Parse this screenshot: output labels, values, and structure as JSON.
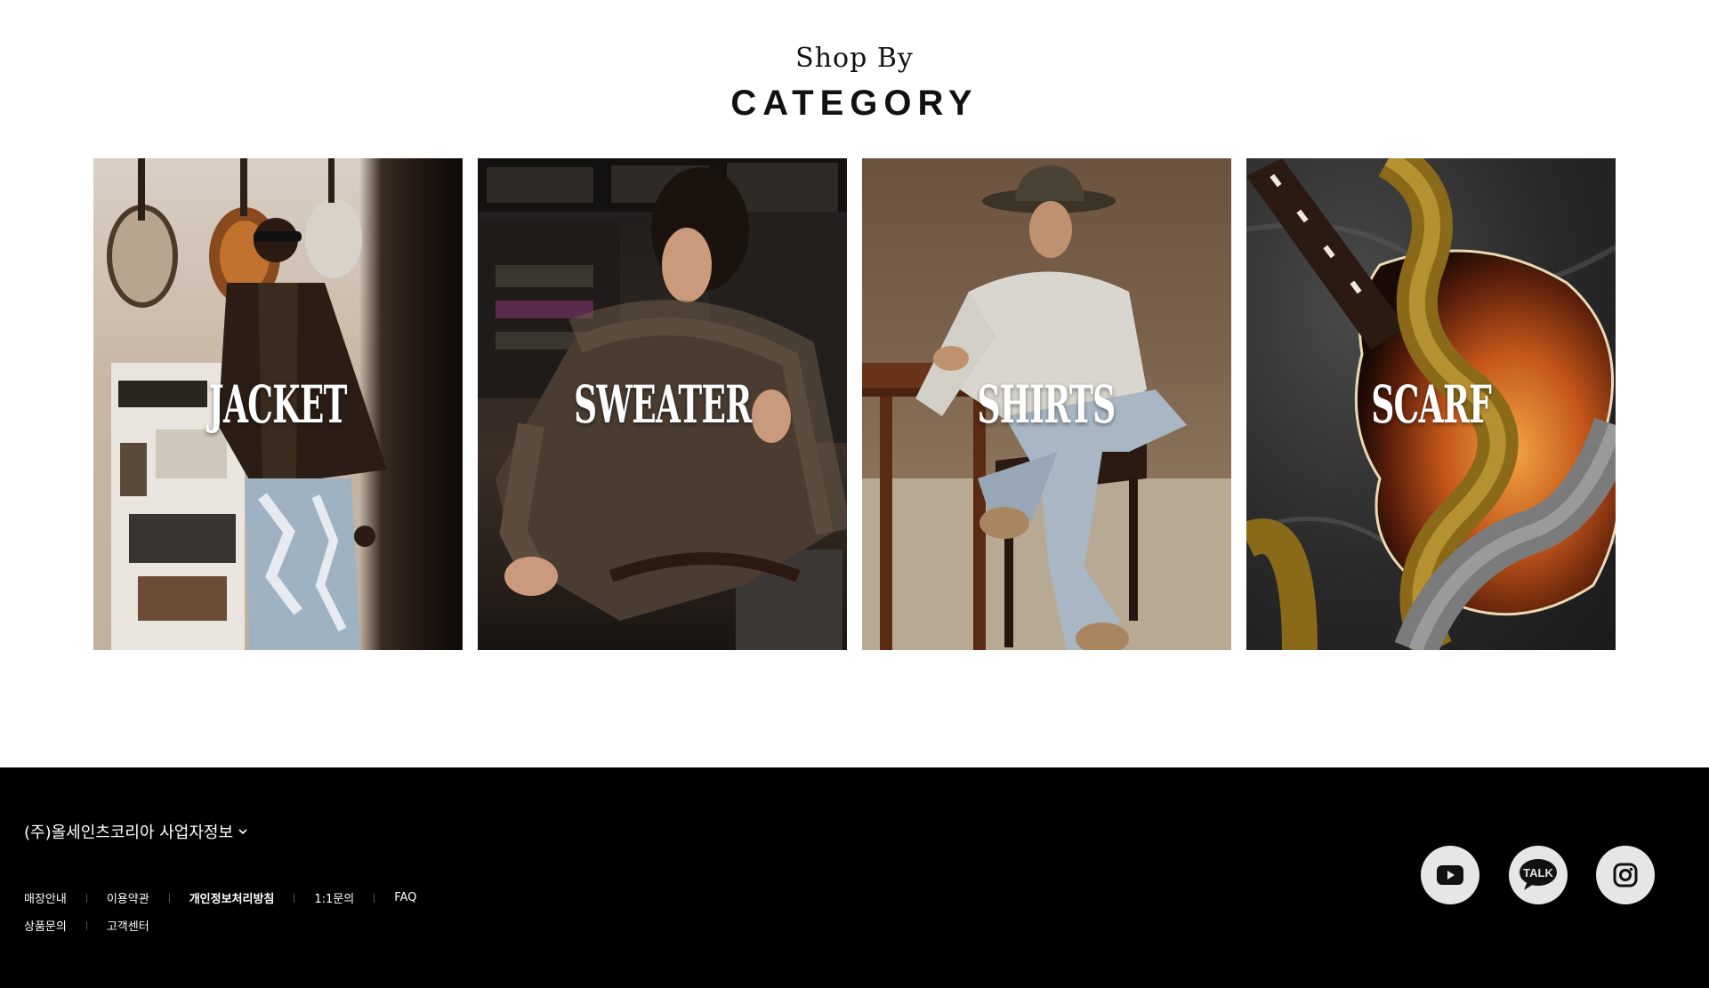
{
  "header": {
    "shop_by": "Shop By",
    "title": "CATEGORY"
  },
  "categories": [
    {
      "label": "JACKET"
    },
    {
      "label": "SWEATER"
    },
    {
      "label": "SHIRTS"
    },
    {
      "label": "SCARF"
    }
  ],
  "footer": {
    "company_info": "(주)올세인츠코리아 사업자정보",
    "links_row1": [
      "매장안내",
      "이용약관",
      "개인정보처리방침",
      "1:1문의",
      "FAQ"
    ],
    "links_row2": [
      "상품문의",
      "고객센터"
    ],
    "social": {
      "youtube_icon": "youtube-icon",
      "kakao_icon": "kakaotalk-icon",
      "kakao_text": "TALK",
      "instagram_icon": "instagram-icon"
    },
    "colors": {
      "background": "#000000",
      "text": "#ffffff",
      "social_bg": "#e6e6e6"
    }
  }
}
